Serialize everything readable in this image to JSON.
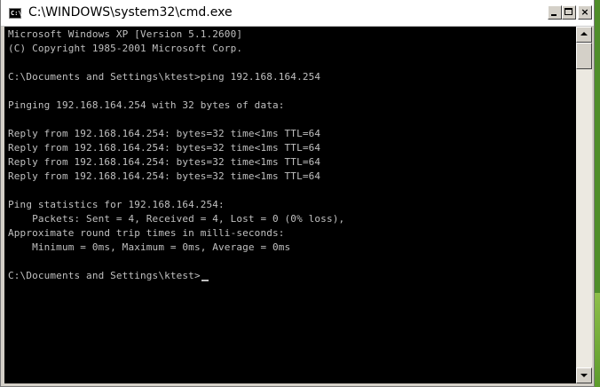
{
  "window": {
    "title": "C:\\WINDOWS\\system32\\cmd.exe",
    "icon_text": "C:\\",
    "icon": "console-icon",
    "buttons": {
      "minimize": "_",
      "maximize": "□",
      "close": "×"
    }
  },
  "console": {
    "lines": [
      "Microsoft Windows XP [Version 5.1.2600]",
      "(C) Copyright 1985-2001 Microsoft Corp.",
      "",
      "C:\\Documents and Settings\\ktest>ping 192.168.164.254",
      "",
      "Pinging 192.168.164.254 with 32 bytes of data:",
      "",
      "Reply from 192.168.164.254: bytes=32 time<1ms TTL=64",
      "Reply from 192.168.164.254: bytes=32 time<1ms TTL=64",
      "Reply from 192.168.164.254: bytes=32 time<1ms TTL=64",
      "Reply from 192.168.164.254: bytes=32 time<1ms TTL=64",
      "",
      "Ping statistics for 192.168.164.254:",
      "    Packets: Sent = 4, Received = 4, Lost = 0 (0% loss),",
      "Approximate round trip times in milli-seconds:",
      "    Minimum = 0ms, Maximum = 0ms, Average = 0ms",
      "",
      "C:\\Documents and Settings\\ktest>"
    ]
  },
  "colors": {
    "console_bg": "#000000",
    "console_text": "#c0c0c0",
    "titlebar_bg": "#ffffff"
  }
}
